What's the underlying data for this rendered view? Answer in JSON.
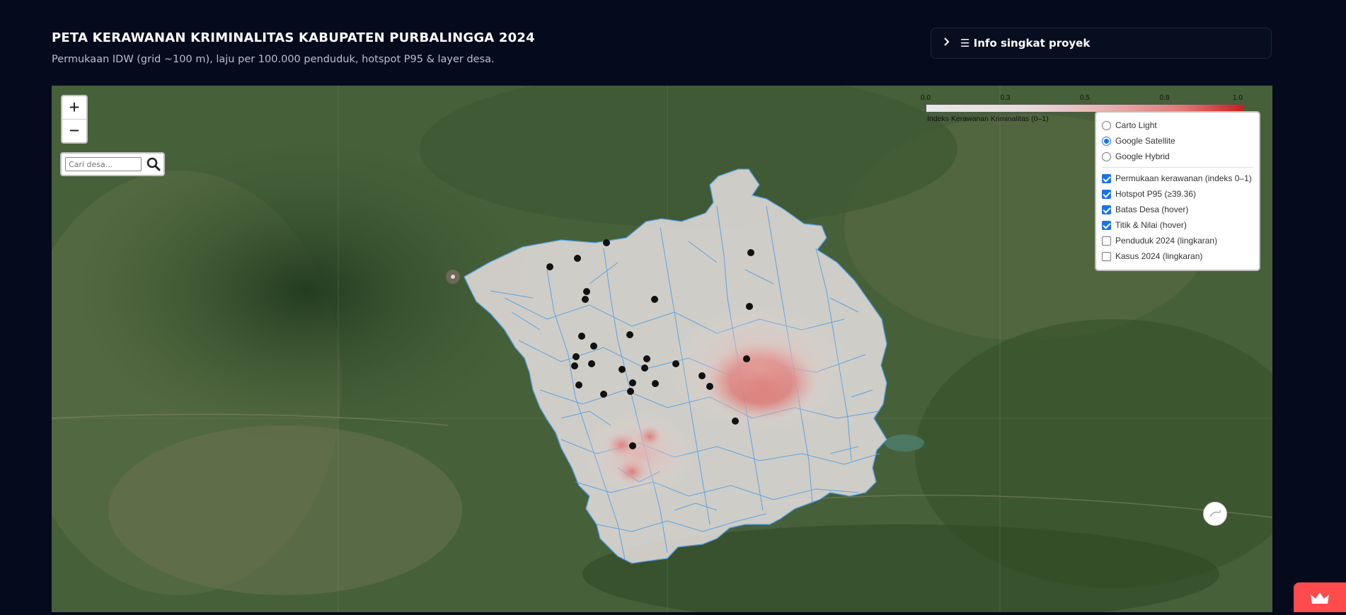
{
  "header": {
    "title": "PETA KERAWANAN KRIMINALITAS KABUPATEN PURBALINGGA 2024",
    "subtitle": "Permukaan IDW (grid ~100 m), laju per 100.000 penduduk, hotspot P95 & layer desa."
  },
  "info_expander": {
    "chevron_icon": "chevron-right-icon",
    "label": "☰ Info singkat proyek"
  },
  "map": {
    "zoom_in": "+",
    "zoom_out": "−",
    "search": {
      "placeholder": "Cari desa...",
      "icon": "search-icon"
    },
    "legend": {
      "ticks": [
        "0.0",
        "0.3",
        "0.5",
        "0.8",
        "1.0"
      ],
      "caption": "Indeks Kerawanan Kriminalitas (0–1)",
      "colors": {
        "low": "#e8e8e8",
        "high": "#c8211c"
      }
    },
    "basemaps": [
      {
        "label": "Carto Light",
        "selected": false
      },
      {
        "label": "Google Satellite",
        "selected": true
      },
      {
        "label": "Google Hybrid",
        "selected": false
      }
    ],
    "overlays": [
      {
        "label": "Permukaan kerawanan (indeks 0–1)",
        "checked": true
      },
      {
        "label": "Hotspot P95 (≥39.36)",
        "checked": true
      },
      {
        "label": "Batas Desa (hover)",
        "checked": true
      },
      {
        "label": "Titik & Nilai (hover)",
        "checked": true
      },
      {
        "label": "Penduduk 2024 (lingkaran)",
        "checked": false
      },
      {
        "label": "Kasus 2024 (lingkaran)",
        "checked": false
      }
    ],
    "colors": {
      "village_border": "#4f9fe8",
      "district_fill": "#e3dcdb",
      "hotspot": "#d83a32",
      "point": "#111111"
    }
  }
}
